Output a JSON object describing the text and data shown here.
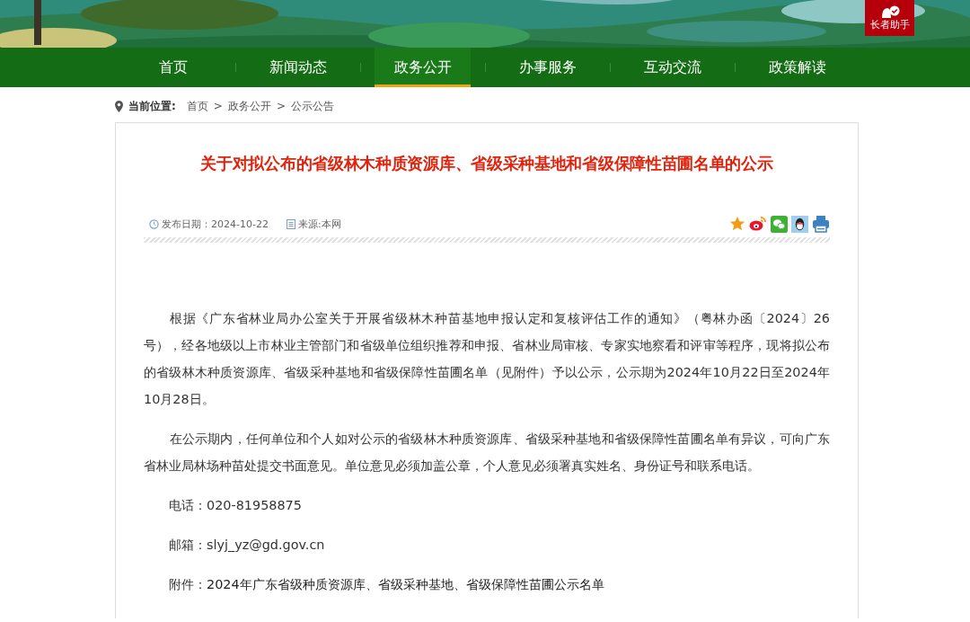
{
  "header": {
    "assist_badge": "长者助手"
  },
  "nav": [
    {
      "label": "首页",
      "selected": false
    },
    {
      "label": "新闻动态",
      "selected": false
    },
    {
      "label": "政务公开",
      "selected": true
    },
    {
      "label": "办事服务",
      "selected": false
    },
    {
      "label": "互动交流",
      "selected": false
    },
    {
      "label": "政策解读",
      "selected": false
    }
  ],
  "breadcrumb": {
    "label": "当前位置:",
    "items": [
      "首页",
      "政务公开",
      "公示公告"
    ],
    "separator": ">"
  },
  "article": {
    "title": "关于对拟公布的省级林木种质资源库、省级采种基地和省级保障性苗圃名单的公示",
    "date": "发布日期：2024-10-22",
    "source": "来源:本网",
    "paragraphs": [
      "根据《广东省林业局办公室关于开展省级林木种苗基地申报认定和复核评估工作的通知》（粤林办函〔2024〕26号），经各地级以上市林业主管部门和省级单位组织推荐和申报、省林业局审核、专家实地察看和评审等程序，现将拟公布的省级林木种质资源库、省级采种基地和省级保障性苗圃名单（见附件）予以公示，公示期为2024年10月22日至2024年10月28日。",
      "在公示期内，任何单位和个人如对公示的省级林木种质资源库、省级采种基地和省级保障性苗圃名单有异议，可向广东省林业局林场种苗处提交书面意见。单位意见必须加盖公章，个人意见必须署真实姓名、身份证号和联系电话。"
    ],
    "contacts": [
      {
        "label": "电话：",
        "value": "020-81958875",
        "kind": "text"
      },
      {
        "label": "邮箱：",
        "value": "slyj_yz@gd.gov.cn",
        "kind": "text"
      },
      {
        "label": "附件：",
        "value": "2024年广东省级种质资源库、省级采种基地、省级保障性苗圃公示名单",
        "kind": "link"
      }
    ]
  }
}
